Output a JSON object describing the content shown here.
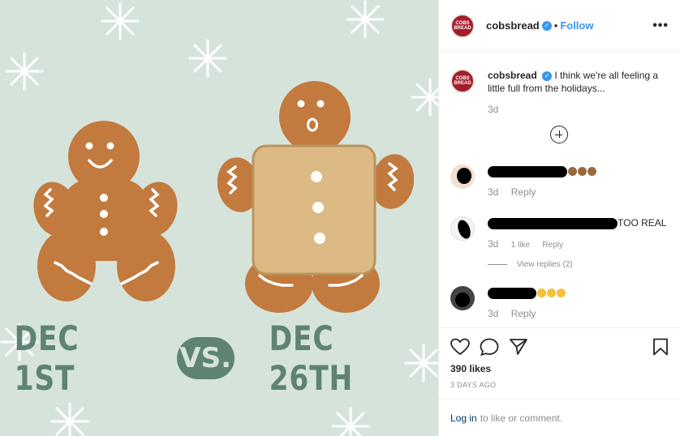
{
  "image": {
    "left_label": "DEC 1ST",
    "vs_label": "VS.",
    "right_label": "DEC 26TH",
    "colors": {
      "background": "#d6e3db",
      "text": "#5e8372",
      "cookie": "#c27a3e",
      "bread": "#ddb985"
    }
  },
  "header": {
    "avatar_text": "COBS BREAD",
    "username": "cobsbread",
    "dot": "•",
    "follow_label": "Follow",
    "more_icon": "•••"
  },
  "caption": {
    "username": "cobsbread",
    "text": "I think we're all feeling a little full from the holidays...",
    "time": "3d"
  },
  "comments": [
    {
      "text": "",
      "time": "3d",
      "reply": "Reply"
    },
    {
      "text": "TOO REAL",
      "time": "3d",
      "likes": "1 like",
      "reply": "Reply",
      "view_replies": "View replies (2)"
    },
    {
      "text": "",
      "time": "3d",
      "reply": "Reply"
    }
  ],
  "actions": {
    "likes": "390 likes",
    "posted": "3 DAYS AGO"
  },
  "login": {
    "link": "Log in",
    "text": "to like or comment."
  }
}
